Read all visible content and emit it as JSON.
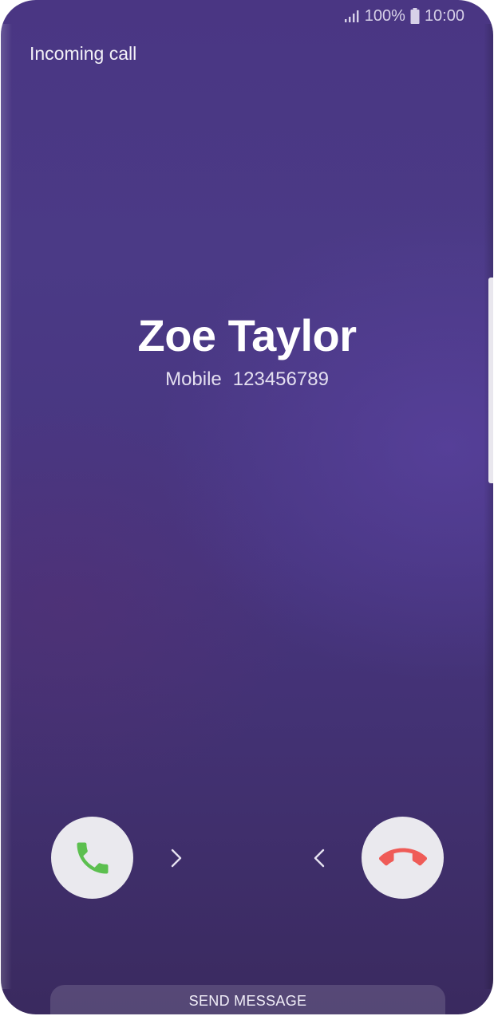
{
  "status_bar": {
    "battery": "100%",
    "time": "10:00",
    "signal_icon": "signal-bars-icon",
    "battery_icon": "battery-icon"
  },
  "header": {
    "title": "Incoming call"
  },
  "caller": {
    "name": "Zoe Taylor",
    "number_type": "Mobile",
    "number": "123456789"
  },
  "actions": {
    "accept_icon": "phone-accept-icon",
    "decline_icon": "phone-decline-icon",
    "accept_color": "#5cbf4f",
    "decline_color": "#ef5b57",
    "send_message_label": "SEND MESSAGE"
  }
}
